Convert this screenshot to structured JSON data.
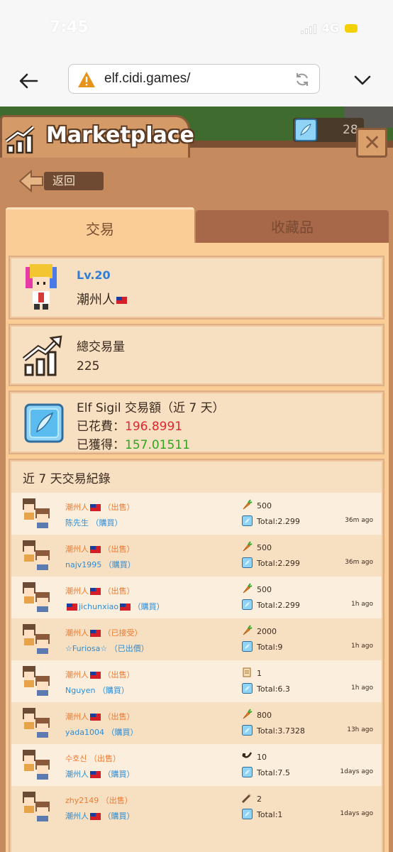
{
  "status": {
    "time": "7:45",
    "network": "4G"
  },
  "browser": {
    "url": "elf.cidi.games/"
  },
  "header": {
    "title": "Marketplace",
    "currency_amount": "28"
  },
  "nav": {
    "return_label": "返回"
  },
  "tabs": [
    {
      "label": "交易"
    },
    {
      "label": "收藏品"
    }
  ],
  "profile": {
    "level": "Lv.20",
    "username": "潮州人"
  },
  "volume": {
    "label": "總交易量",
    "value": "225"
  },
  "sigil": {
    "title": "Elf Sigil 交易額（近 7 天）",
    "spent_label": "已花費：",
    "spent_value": "196.8991",
    "gained_label": "已獲得：",
    "gained_value": "157.01511"
  },
  "history": {
    "title": "近 7 天交易紀錄",
    "rows": [
      {
        "seller": "潮州人",
        "seller_flag": true,
        "seller_note": "（出售）",
        "buyer_pre_flag": false,
        "buyer": "陈先生",
        "buyer_flag": false,
        "buyer_note": "（購買）",
        "item_icon": "carrot-icon",
        "qty": "500",
        "total": "Total:2.299",
        "time": "36m ago"
      },
      {
        "seller": "潮州人",
        "seller_flag": true,
        "seller_note": "（出售）",
        "buyer_pre_flag": false,
        "buyer": "najv1995",
        "buyer_flag": false,
        "buyer_note": "（購買）",
        "item_icon": "carrot-icon",
        "qty": "500",
        "total": "Total:2.299",
        "time": "36m ago"
      },
      {
        "seller": "潮州人",
        "seller_flag": true,
        "seller_note": "（出售）",
        "buyer_pre_flag": true,
        "buyer": "jichunxiao",
        "buyer_flag": true,
        "buyer_note": "（購買）",
        "item_icon": "carrot-icon",
        "qty": "500",
        "total": "Total:2.299",
        "time": "1h ago"
      },
      {
        "seller": "潮州人",
        "seller_flag": true,
        "seller_note": "（已接受）",
        "buyer_pre_flag": false,
        "buyer": "☆Furiosa☆",
        "buyer_flag": false,
        "buyer_note": "（已出價）",
        "item_icon": "carrot-icon",
        "qty": "2000",
        "total": "Total:9",
        "time": "1h ago"
      },
      {
        "seller": "潮州人",
        "seller_flag": true,
        "seller_note": "（出售）",
        "buyer_pre_flag": false,
        "buyer": "Nguyen",
        "buyer_flag": false,
        "buyer_note": "（購買）",
        "item_icon": "scroll-icon",
        "qty": "1",
        "total": "Total:6.3",
        "time": "1h ago"
      },
      {
        "seller": "潮州人",
        "seller_flag": true,
        "seller_note": "（出售）",
        "buyer_pre_flag": false,
        "buyer": "yada1004",
        "buyer_flag": false,
        "buyer_note": "（購買）",
        "item_icon": "carrot-icon",
        "qty": "800",
        "total": "Total:3.7328",
        "time": "13h ago"
      },
      {
        "seller": "수호신",
        "seller_flag": false,
        "seller_note": "（出售）",
        "buyer_pre_flag": false,
        "buyer": "潮州人",
        "buyer_flag": true,
        "buyer_note": "（購買）",
        "item_icon": "pipe-icon",
        "qty": "10",
        "total": "Total:7.5",
        "time": "1days ago"
      },
      {
        "seller": "zhy2149",
        "seller_flag": false,
        "seller_note": "（出售）",
        "buyer_pre_flag": false,
        "buyer": "潮州人",
        "buyer_flag": true,
        "buyer_note": "（購買）",
        "item_icon": "wand-icon",
        "qty": "2",
        "total": "Total:1",
        "time": "1days ago"
      }
    ]
  }
}
